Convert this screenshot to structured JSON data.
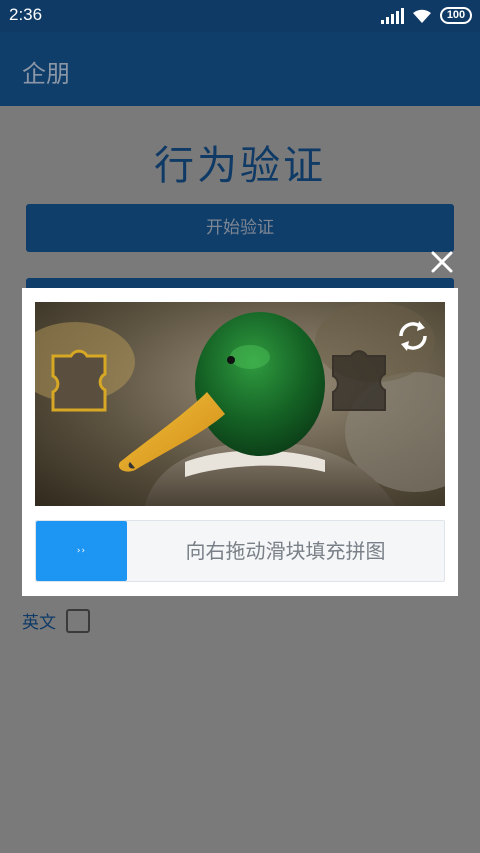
{
  "status_bar": {
    "time": "2:36",
    "battery": "100",
    "icons": [
      "signal-icon",
      "wifi-icon",
      "battery-icon"
    ]
  },
  "app_bar": {
    "title": "企朋"
  },
  "page": {
    "title": "行为验证",
    "start_button": "开始验证",
    "language_label": "英文",
    "language_checked": false
  },
  "captcha": {
    "close_icon": "close-icon",
    "refresh_icon": "refresh-icon",
    "slider_handle": "››",
    "slider_hint": "向右拖动滑块填充拼图",
    "slider_progress": 0
  },
  "colors": {
    "status_bar": "#0f3a66",
    "app_bar": "#103e6b",
    "accent": "#1d96f3",
    "overlay": "#7a7a7a"
  }
}
